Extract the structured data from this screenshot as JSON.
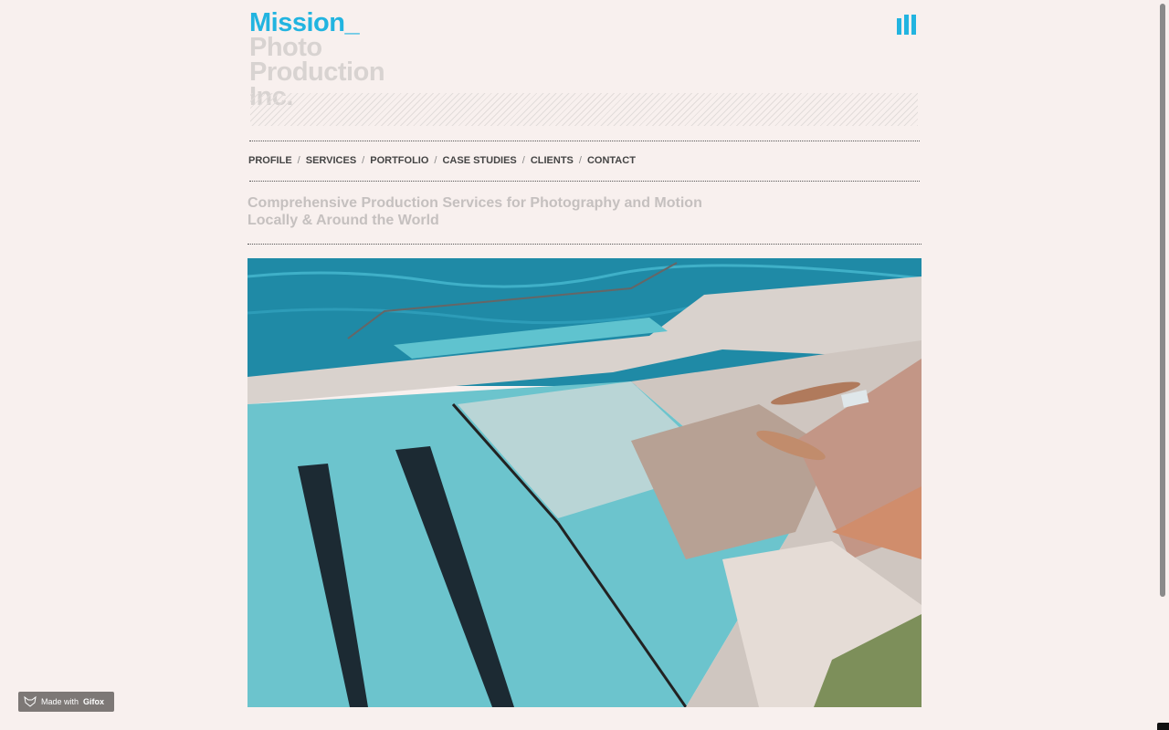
{
  "brand": {
    "line1": "Mission_",
    "line2": "Photo",
    "line3": "Production",
    "line4": "Inc.",
    "accent_color": "#22b4e0"
  },
  "header": {
    "menu_icon": "bars-icon"
  },
  "nav": {
    "items": [
      {
        "label": "PROFILE"
      },
      {
        "label": "SERVICES"
      },
      {
        "label": "PORTFOLIO"
      },
      {
        "label": "CASE STUDIES"
      },
      {
        "label": "CLIENTS"
      },
      {
        "label": "CONTACT"
      }
    ],
    "separator": "/"
  },
  "tagline": {
    "line1": "Comprehensive Production Services for Photography and Motion",
    "line2": "Locally & Around the World"
  },
  "hero": {
    "description_icon": "hero-photo"
  },
  "badge": {
    "prefix": "Made with",
    "brand": "Gifox",
    "icon": "fox-icon"
  }
}
